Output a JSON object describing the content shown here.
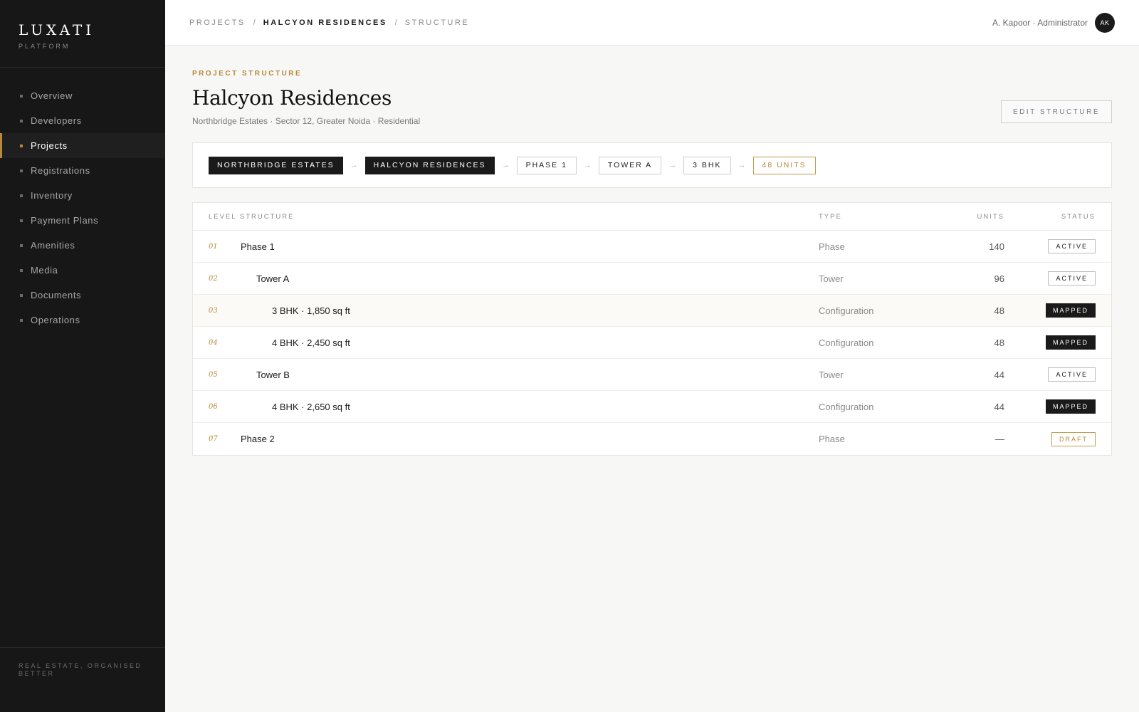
{
  "brand": {
    "name": "LUXATI",
    "subtitle": "PLATFORM"
  },
  "sidebar": {
    "items": [
      {
        "label": "Overview",
        "active": false
      },
      {
        "label": "Developers",
        "active": false
      },
      {
        "label": "Projects",
        "active": true
      },
      {
        "label": "Registrations",
        "active": false
      },
      {
        "label": "Inventory",
        "active": false
      },
      {
        "label": "Payment Plans",
        "active": false
      },
      {
        "label": "Amenities",
        "active": false
      },
      {
        "label": "Media",
        "active": false
      },
      {
        "label": "Documents",
        "active": false
      },
      {
        "label": "Operations",
        "active": false
      }
    ],
    "footer": "REAL ESTATE, ORGANISED BETTER"
  },
  "header": {
    "breadcrumb": [
      "PROJECTS",
      "HALCYON RESIDENCES",
      "STRUCTURE"
    ],
    "separator": "/",
    "user_label": "A. Kapoor · Administrator",
    "avatar_initials": "AK"
  },
  "page": {
    "eyebrow": "PROJECT STRUCTURE",
    "title": "Halcyon Residences",
    "subtitle": "Northbridge Estates · Sector 12, Greater Noida · Residential",
    "edit_label": "EDIT STRUCTURE"
  },
  "path": {
    "arrow": "→",
    "chips": [
      {
        "label": "NORTHBRIDGE ESTATES",
        "style": "dark"
      },
      {
        "label": "HALCYON RESIDENCES",
        "style": "dark"
      },
      {
        "label": "PHASE 1",
        "style": "outline"
      },
      {
        "label": "TOWER A",
        "style": "outline"
      },
      {
        "label": "3 BHK",
        "style": "outline"
      },
      {
        "label": "48 UNITS",
        "style": "gold"
      }
    ]
  },
  "table": {
    "headers": {
      "level": "LEVEL STRUCTURE",
      "type": "TYPE",
      "units": "UNITS",
      "status": "STATUS"
    },
    "rows": [
      {
        "idx": "01",
        "name": "Phase 1",
        "depth": 0,
        "type": "Phase",
        "units": "140",
        "status": "ACTIVE",
        "status_style": "active"
      },
      {
        "idx": "02",
        "name": "Tower A",
        "depth": 1,
        "type": "Tower",
        "units": "96",
        "status": "ACTIVE",
        "status_style": "active"
      },
      {
        "idx": "03",
        "name": "3 BHK · 1,850 sq ft",
        "depth": 2,
        "type": "Configuration",
        "units": "48",
        "status": "MAPPED",
        "status_style": "mapped",
        "highlight": true
      },
      {
        "idx": "04",
        "name": "4 BHK · 2,450 sq ft",
        "depth": 2,
        "type": "Configuration",
        "units": "48",
        "status": "MAPPED",
        "status_style": "mapped"
      },
      {
        "idx": "05",
        "name": "Tower B",
        "depth": 1,
        "type": "Tower",
        "units": "44",
        "status": "ACTIVE",
        "status_style": "active"
      },
      {
        "idx": "06",
        "name": "4 BHK · 2,650 sq ft",
        "depth": 2,
        "type": "Configuration",
        "units": "44",
        "status": "MAPPED",
        "status_style": "mapped"
      },
      {
        "idx": "07",
        "name": "Phase 2",
        "depth": 0,
        "type": "Phase",
        "units": "—",
        "status": "DRAFT",
        "status_style": "draft"
      }
    ]
  },
  "colors": {
    "accent": "#b8893a",
    "sidebar_bg": "#171717",
    "page_bg": "#f7f7f6"
  }
}
